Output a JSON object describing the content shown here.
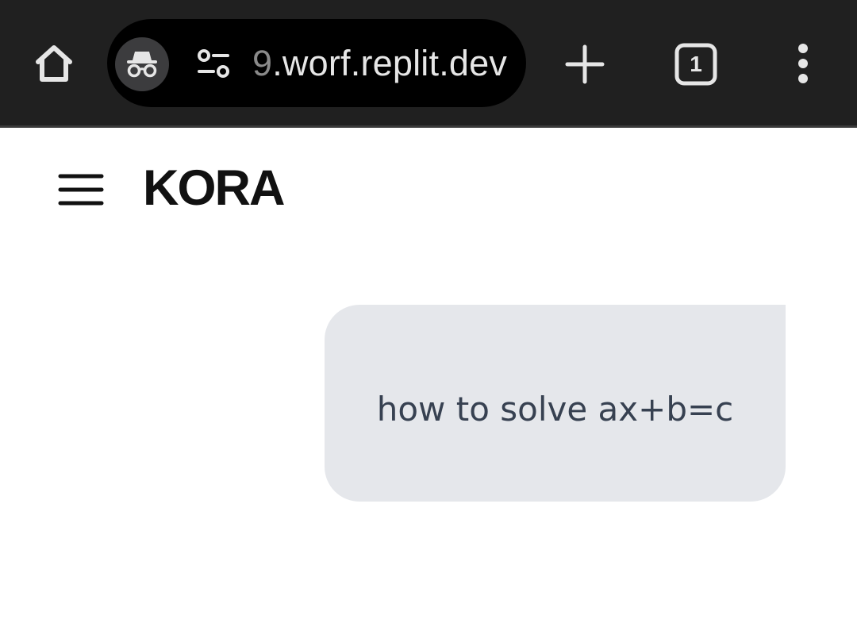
{
  "browser": {
    "url_prefix": "9",
    "url_main": ".worf.replit.dev",
    "tab_count": "1"
  },
  "app": {
    "title": "KORA"
  },
  "chat": {
    "messages": [
      {
        "role": "user",
        "text": "how to solve ax+b=c"
      }
    ]
  },
  "colors": {
    "toolbar_bg": "#202020",
    "url_pill_bg": "#000000",
    "bubble_bg": "#e5e7eb",
    "bubble_text": "#374151"
  },
  "icons": {
    "home": "home-icon",
    "incognito": "incognito-icon",
    "site_settings": "site-settings-icon",
    "new_tab": "plus-icon",
    "tabs": "tab-switcher-icon",
    "menu": "more-vert-icon",
    "hamburger": "hamburger-menu-icon"
  }
}
